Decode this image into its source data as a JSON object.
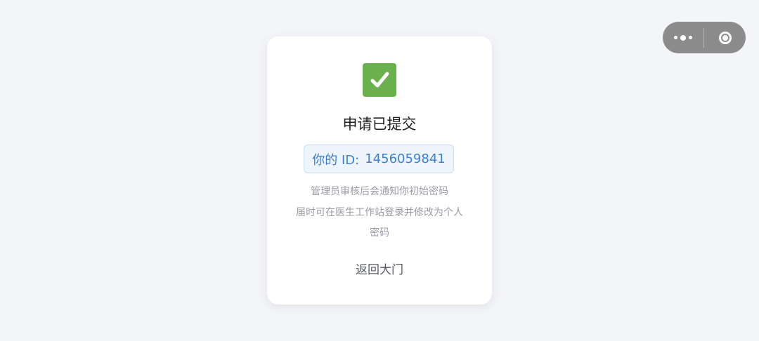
{
  "capsule": {
    "more_icon": "more-dots-icon",
    "close_icon": "target-ring-icon"
  },
  "card": {
    "status_icon": "check-mark-icon",
    "status_color": "#6ab04c",
    "title": "申请已提交",
    "id_label": "你的 ID:",
    "id_value": "1456059841",
    "description_line1": "管理员审核后会通知你初始密码",
    "description_line2": "届时可在医生工作站登录并修改为个人",
    "description_line3": "密码",
    "back_label": "返回大门"
  }
}
